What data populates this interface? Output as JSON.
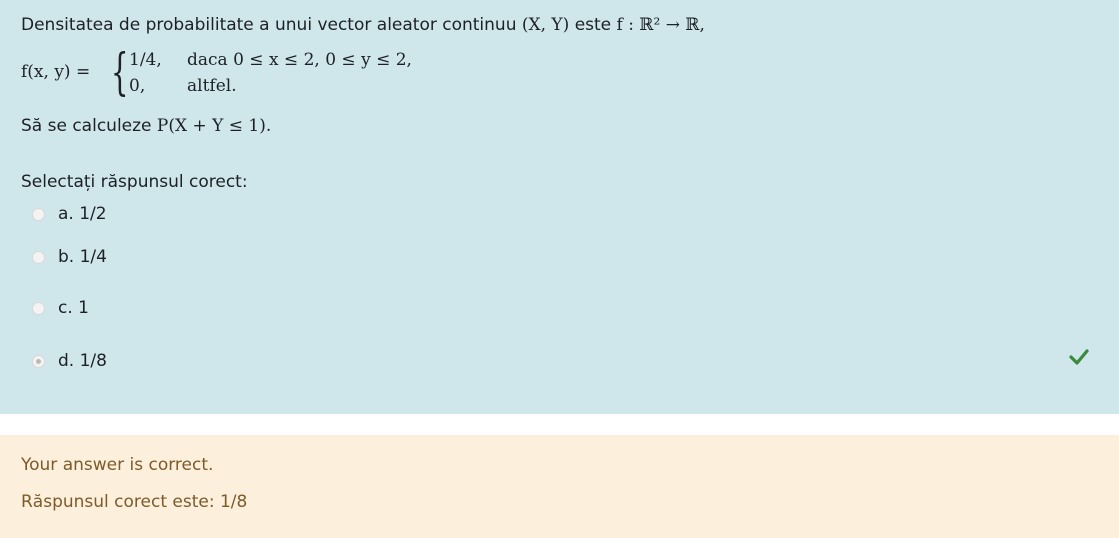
{
  "question": {
    "intro_text": "Densitatea de probabilitate a unui vector aleator continuu ",
    "intro_math_vector": "(X, Y)",
    "intro_mid": " este ",
    "intro_math_func": "f : ℝ² → ℝ,",
    "formula": {
      "lhs": "f(x, y) =",
      "row1_value": "1/4,",
      "row1_condition": "daca 0 ≤ x ≤ 2,  0 ≤ y ≤ 2,",
      "row2_value": "0,",
      "row2_condition": "altfel."
    },
    "ask_text": "Să se calculeze ",
    "ask_math": "P(X + Y ≤ 1)."
  },
  "prompt": "Selectați răspunsul corect:",
  "options": [
    {
      "label": "a. 1/2",
      "selected": false
    },
    {
      "label": "b. 1/4",
      "selected": false
    },
    {
      "label": "c. 1",
      "selected": false
    },
    {
      "label": "d. 1/8",
      "selected": true
    }
  ],
  "correct_icon": "checkmark-icon",
  "colors": {
    "question_bg": "#cfe6eb",
    "feedback_bg": "#fcefdc",
    "feedback_text": "#7d5a29",
    "check_green": "#3a8a3a"
  },
  "feedback": {
    "status": "Your answer is correct.",
    "correct_answer": "Răspunsul corect este: 1/8"
  }
}
